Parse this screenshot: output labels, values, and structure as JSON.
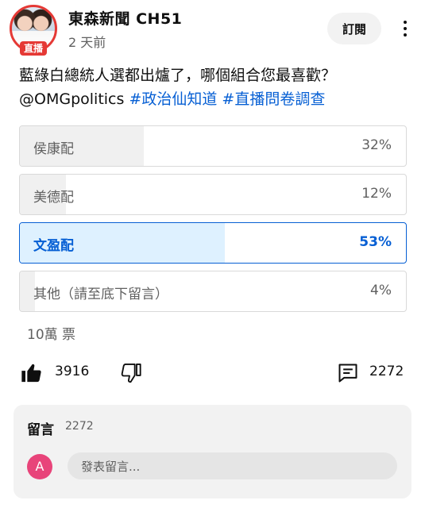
{
  "header": {
    "channel_name": "東森新聞 CH51",
    "live_badge": "直播",
    "timestamp": "2 天前",
    "subscribe_label": "訂閱"
  },
  "post": {
    "question": "藍綠白總統人選都出爐了，哪個組合您最喜歡？",
    "handle": "@OMGpolitics",
    "hashtags": [
      "#政治仙知道",
      "#直播問卷調查"
    ]
  },
  "poll": {
    "options": [
      {
        "label": "侯康配",
        "percent": "32%",
        "fraction": 0.32,
        "selected": false
      },
      {
        "label": "美德配",
        "percent": "12%",
        "fraction": 0.12,
        "selected": false
      },
      {
        "label": "文盈配",
        "percent": "53%",
        "fraction": 0.53,
        "selected": true
      },
      {
        "label": "其他（請至底下留言）",
        "percent": "4%",
        "fraction": 0.04,
        "selected": false
      }
    ],
    "votes": "10萬 票"
  },
  "actions": {
    "like_count": "3916",
    "comment_count": "2272"
  },
  "comments": {
    "title": "留言",
    "count": "2272",
    "user_initial": "A",
    "input_placeholder": "發表留言..."
  },
  "colors": {
    "accent": "#065fd4",
    "selected_fill": "#def1ff",
    "badge_red": "#e53935",
    "avatar_pink": "#e8447a"
  }
}
